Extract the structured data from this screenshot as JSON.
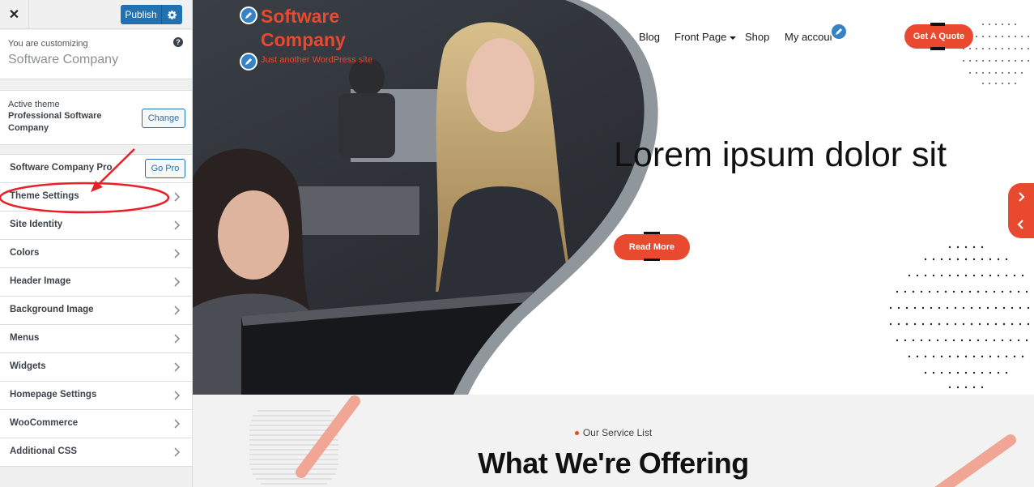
{
  "sidebar": {
    "publish_label": "Publish",
    "customizing_label": "You are customizing",
    "site_name": "Software Company",
    "active_theme_label": "Active theme",
    "theme_name": "Professional Software Company",
    "change_label": "Change",
    "pro_label": "Software Company Pro",
    "go_pro_label": "Go Pro",
    "items": [
      {
        "label": "Theme Settings"
      },
      {
        "label": "Site Identity"
      },
      {
        "label": "Colors"
      },
      {
        "label": "Header Image"
      },
      {
        "label": "Background Image"
      },
      {
        "label": "Menus"
      },
      {
        "label": "Widgets"
      },
      {
        "label": "Homepage Settings"
      },
      {
        "label": "WooCommerce"
      },
      {
        "label": "Additional CSS"
      }
    ]
  },
  "preview": {
    "site_title": "Software Company",
    "tagline": "Just another WordPress site",
    "nav": [
      "Blog",
      "Front Page",
      "Shop",
      "My account"
    ],
    "quote_label": "Get A Quote",
    "hero_heading": "Lorem ipsum dolor sit",
    "read_more_label": "Read More",
    "services_sub": "Our Service List",
    "services_title": "What We're Offering"
  },
  "colors": {
    "accent": "#e8492f",
    "wp_blue": "#2271b1",
    "annotation_red": "#e8202a"
  },
  "icons": [
    "close-icon",
    "gear-icon",
    "help-icon",
    "chevron-right-icon",
    "pencil-icon",
    "caret-down-icon"
  ]
}
